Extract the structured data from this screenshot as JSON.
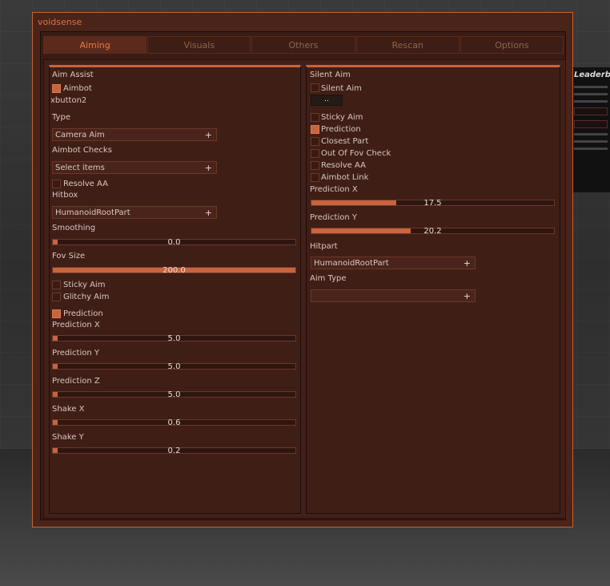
{
  "window": {
    "title": "voidsense"
  },
  "tabs": [
    "Aiming",
    "Visuals",
    "Others",
    "Rescan",
    "Options"
  ],
  "background": {
    "leaderboard_title": "Leaderb"
  },
  "left": {
    "section": "Aim Assist",
    "aimbot_label": "Aimbot",
    "aimbot_checked": true,
    "keybind": "xbutton2",
    "type_label": "Type",
    "type_value": "Camera Aim",
    "checks_label": "Aimbot Checks",
    "checks_value": "Select items",
    "resolve_label": "Resolve AA",
    "resolve_checked": false,
    "hitbox_label": "Hitbox",
    "hitbox_value": "HumanoidRootPart",
    "smoothing_label": "Smoothing",
    "smoothing_value": "0.0",
    "smoothing_fill": 0.0,
    "fov_label": "Fov Size",
    "fov_value": "200.0",
    "fov_fill": 1.0,
    "sticky_label": "Sticky Aim",
    "sticky_checked": false,
    "glitchy_label": "Glitchy Aim",
    "glitchy_checked": false,
    "prediction_label": "Prediction",
    "prediction_checked": true,
    "predx_label": "Prediction X",
    "predx_value": "5.0",
    "predy_label": "Prediction Y",
    "predy_value": "5.0",
    "predz_label": "Prediction Z",
    "predz_value": "5.0",
    "shakex_label": "Shake X",
    "shakex_value": "0.6",
    "shakey_label": "Shake Y",
    "shakey_value": "0.2"
  },
  "right": {
    "section": "Silent Aim",
    "silent_label": "Silent Aim",
    "silent_checked": false,
    "keybind": "..",
    "sticky_label": "Sticky Aim",
    "sticky_checked": false,
    "prediction_label": "Prediction",
    "prediction_checked": true,
    "closest_label": "Closest Part",
    "closest_checked": false,
    "outfov_label": "Out Of Fov Check",
    "outfov_checked": false,
    "resolve_label": "Resolve AA",
    "resolve_checked": false,
    "link_label": "Aimbot Link",
    "link_checked": false,
    "predx_label": "Prediction X",
    "predx_value": "17.5",
    "predx_fill": 0.35,
    "predy_label": "Prediction Y",
    "predy_value": "20.2",
    "predy_fill": 0.41,
    "hitpart_label": "Hitpart",
    "hitpart_value": "HumanoidRootPart",
    "aimtype_label": "Aim Type",
    "aimtype_value": ""
  },
  "colors": {
    "accent": "#c8643e",
    "window_border": "#c0643a",
    "title": "#e07044"
  }
}
